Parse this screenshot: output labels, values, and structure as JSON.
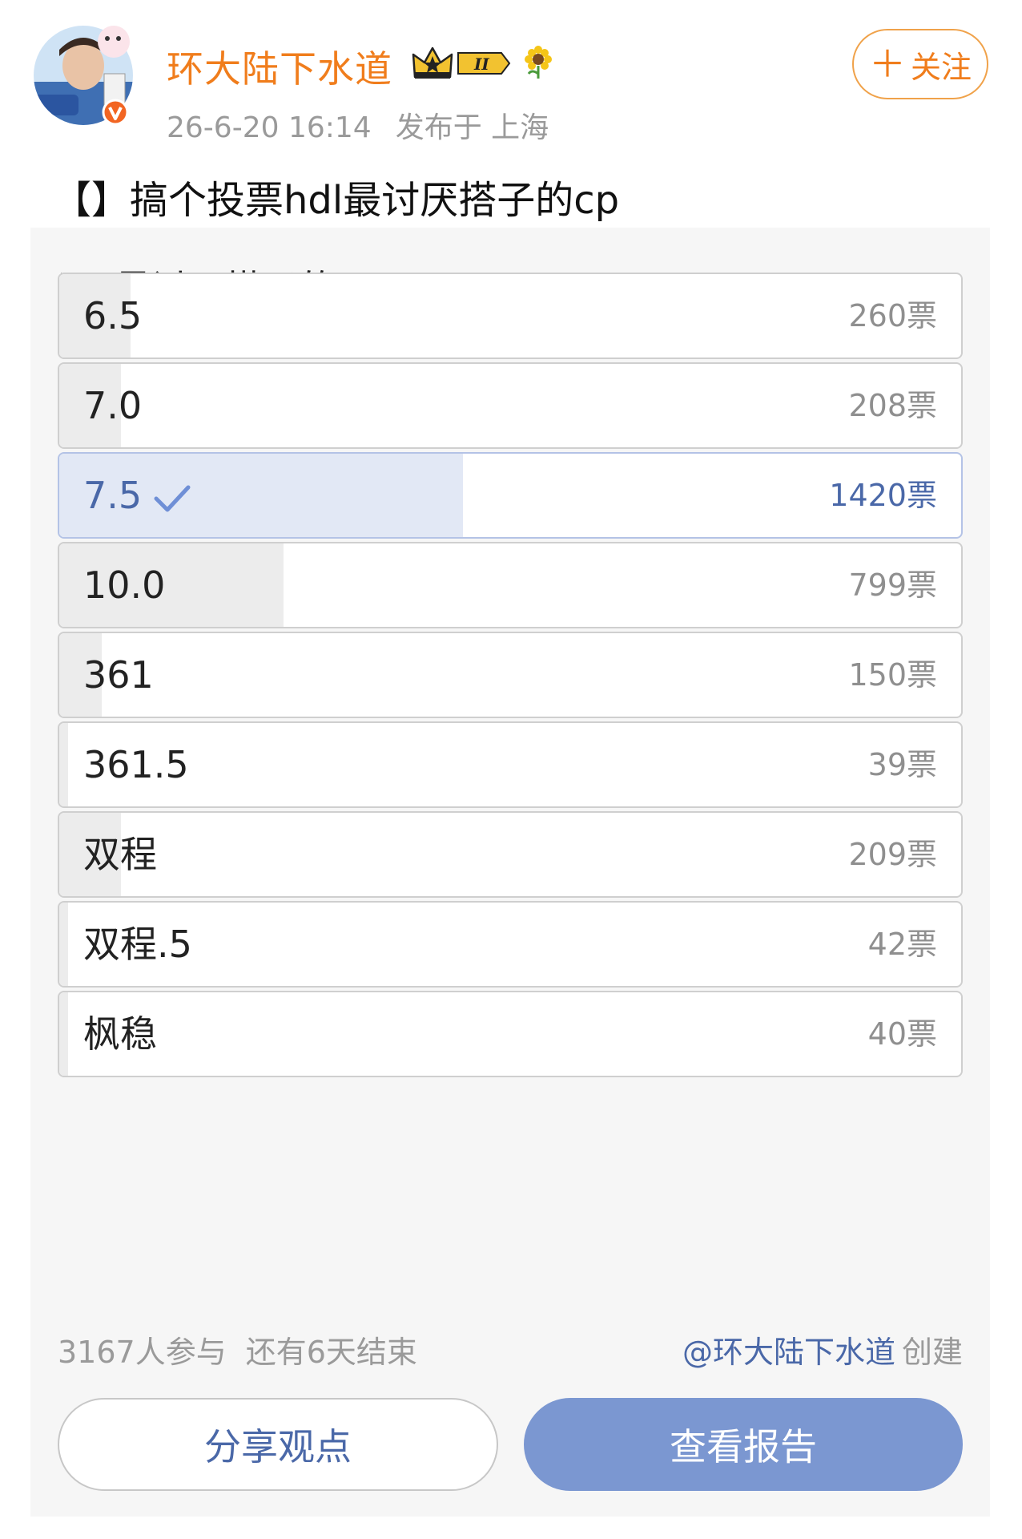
{
  "post": {
    "username": "环大陆下水道",
    "timestamp": "26-6-20 16:14",
    "location": "发布于 上海",
    "follow_label": "关注",
    "follow_plus": "＋",
    "text": "【】搞个投票hdl最讨厌搭子的cp",
    "badge_level": "II",
    "colors": {
      "username": "#f07d1c",
      "accent_blue": "#4a68a8",
      "report_button": "#7b97d1"
    }
  },
  "poll": {
    "title": "hdl最讨厌搭子的cp",
    "options": [
      {
        "label": "6.5",
        "votes": "260票",
        "share": 0.079,
        "selected": false
      },
      {
        "label": "7.0",
        "votes": "208票",
        "share": 0.068,
        "selected": false
      },
      {
        "label": "7.5",
        "votes": "1420票",
        "share": 0.448,
        "selected": true
      },
      {
        "label": "10.0",
        "votes": "799票",
        "share": 0.249,
        "selected": false
      },
      {
        "label": "361",
        "votes": "150票",
        "share": 0.047,
        "selected": false
      },
      {
        "label": "361.5",
        "votes": "39票",
        "share": 0.01,
        "selected": false
      },
      {
        "label": "双程",
        "votes": "209票",
        "share": 0.068,
        "selected": false
      },
      {
        "label": "双程.5",
        "votes": "42票",
        "share": 0.01,
        "selected": false
      },
      {
        "label": "枫稳",
        "votes": "40票",
        "share": 0.01,
        "selected": false
      }
    ],
    "participants": "3167人参与",
    "remaining": "还有6天结束",
    "creator": "@环大陆下水道",
    "created_suffix": "创建",
    "share_button": "分享观点",
    "report_button": "查看报告"
  }
}
